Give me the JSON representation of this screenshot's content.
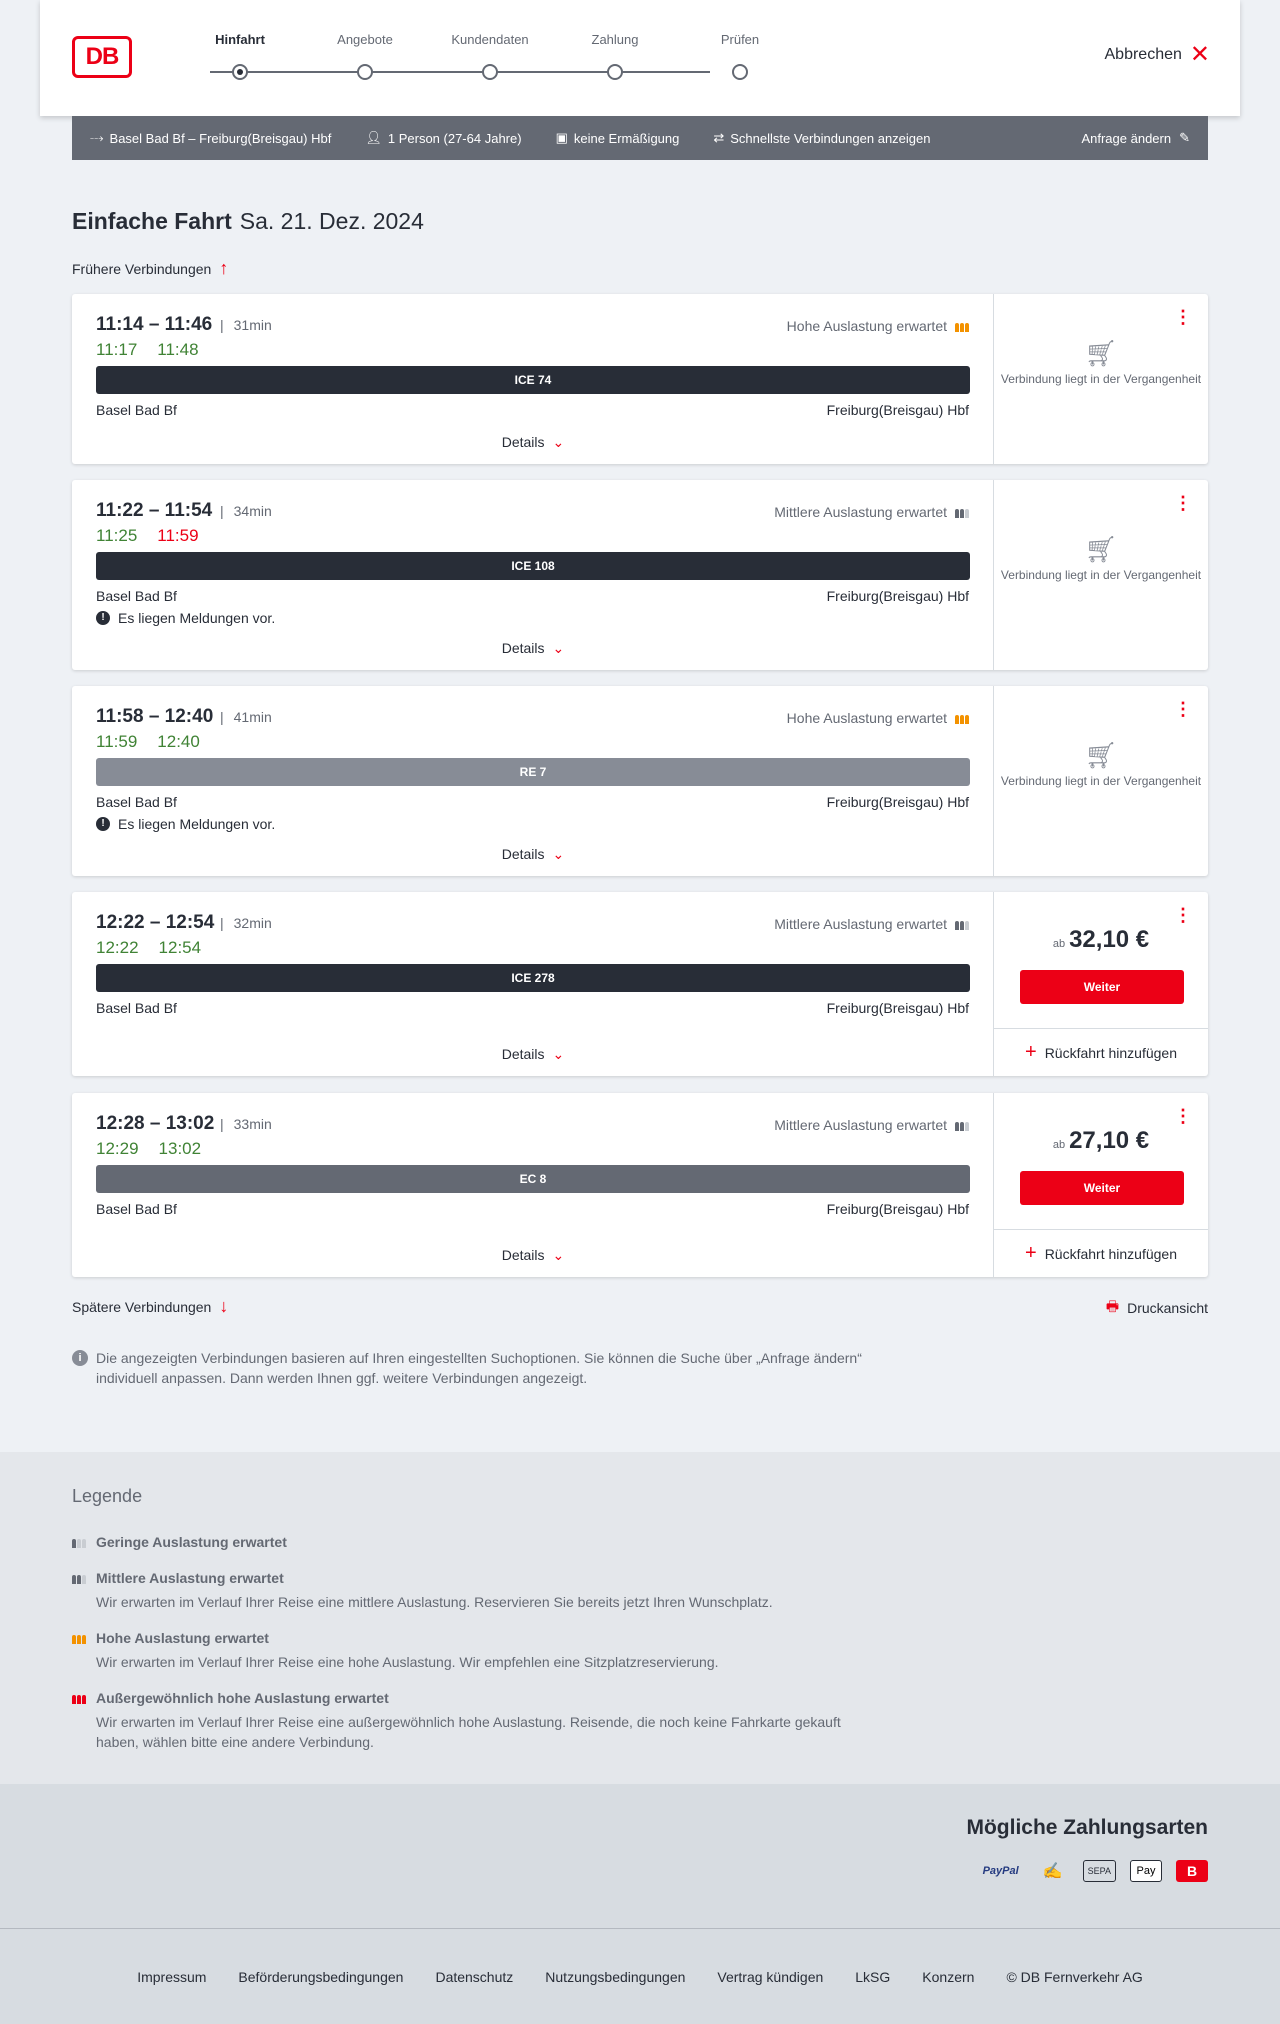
{
  "header": {
    "logo": "DB",
    "steps": [
      "Hinfahrt",
      "Angebote",
      "Kundendaten",
      "Zahlung",
      "Prüfen"
    ],
    "active_step": "Hinfahrt",
    "cancel_label": "Abbrechen"
  },
  "query": {
    "route": "Basel Bad Bf – Freiburg(Breisgau) Hbf",
    "passengers": "1 Person (27-64 Jahre)",
    "discount": "keine Ermäßigung",
    "option": "Schnellste Verbindungen anzeigen",
    "edit_label": "Anfrage ändern"
  },
  "title": {
    "kind": "Einfache Fahrt",
    "date": "Sa. 21. Dez. 2024"
  },
  "earlier_label": "Frühere Verbindungen",
  "later_label": "Spätere Verbindungen",
  "details_label": "Details",
  "past_label": "Verbindung liegt in der Vergangenheit",
  "price_prefix": "ab",
  "continue_label": "Weiter",
  "add_return_label": "Rückfahrt hinzufügen",
  "connections": [
    {
      "time": "11:14 – 11:46",
      "duration": "31min",
      "rt_dep": "11:17",
      "rt_arr": "11:48",
      "rt_arr_late": false,
      "occupancy": "Hohe Auslastung erwartet",
      "occupancy_level": "high",
      "train": "ICE 74",
      "train_style": "dark",
      "from": "Basel Bad Bf",
      "to": "Freiburg(Breisgau) Hbf",
      "message": "",
      "status": "past",
      "price": ""
    },
    {
      "time": "11:22 – 11:54",
      "duration": "34min",
      "rt_dep": "11:25",
      "rt_arr": "11:59",
      "rt_arr_late": true,
      "occupancy": "Mittlere Auslastung erwartet",
      "occupancy_level": "mid",
      "train": "ICE 108",
      "train_style": "dark",
      "from": "Basel Bad Bf",
      "to": "Freiburg(Breisgau) Hbf",
      "message": "Es liegen Meldungen vor.",
      "status": "past",
      "price": ""
    },
    {
      "time": "11:58 – 12:40",
      "duration": "41min",
      "rt_dep": "11:59",
      "rt_arr": "12:40",
      "rt_arr_late": false,
      "occupancy": "Hohe Auslastung erwartet",
      "occupancy_level": "high",
      "train": "RE 7",
      "train_style": "grey",
      "from": "Basel Bad Bf",
      "to": "Freiburg(Breisgau) Hbf",
      "message": "Es liegen Meldungen vor.",
      "status": "past",
      "price": ""
    },
    {
      "time": "12:22 – 12:54",
      "duration": "32min",
      "rt_dep": "12:22",
      "rt_arr": "12:54",
      "rt_arr_late": false,
      "occupancy": "Mittlere Auslastung erwartet",
      "occupancy_level": "mid",
      "train": "ICE 278",
      "train_style": "dark",
      "from": "Basel Bad Bf",
      "to": "Freiburg(Breisgau) Hbf",
      "message": "",
      "status": "bookable",
      "price": "32,10 €"
    },
    {
      "time": "12:28 – 13:02",
      "duration": "33min",
      "rt_dep": "12:29",
      "rt_arr": "13:02",
      "rt_arr_late": false,
      "occupancy": "Mittlere Auslastung erwartet",
      "occupancy_level": "mid",
      "train": "EC 8",
      "train_style": "mid",
      "from": "Basel Bad Bf",
      "to": "Freiburg(Breisgau) Hbf",
      "message": "",
      "status": "bookable",
      "price": "27,10 €"
    }
  ],
  "print_label": "Druckansicht",
  "info_note": "Die angezeigten Verbindungen basieren auf Ihren eingestellten Suchoptionen. Sie können die Suche über „Anfrage ändern“ individuell anpassen. Dann werden Ihnen ggf. weitere Verbindungen angezeigt.",
  "legend": {
    "title": "Legende",
    "items": [
      {
        "title": "Geringe Auslastung erwartet",
        "desc": "",
        "level": "low"
      },
      {
        "title": "Mittlere Auslastung erwartet",
        "desc": "Wir erwarten im Verlauf Ihrer Reise eine mittlere Auslastung. Reservieren Sie bereits jetzt Ihren Wunschplatz.",
        "level": "mid"
      },
      {
        "title": "Hohe Auslastung erwartet",
        "desc": "Wir erwarten im Verlauf Ihrer Reise eine hohe Auslastung. Wir empfehlen eine Sitzplatzreservierung.",
        "level": "high"
      },
      {
        "title": "Außergewöhnlich hohe Auslastung erwartet",
        "desc": "Wir erwarten im Verlauf Ihrer Reise eine außergewöhnlich hohe Auslastung. Reisende, die noch keine Fahrkarte gekauft haben, wählen bitte eine andere Verbindung.",
        "level": "very-high"
      }
    ]
  },
  "payment": {
    "title": "Mögliche Zahlungsarten",
    "methods": [
      "PayPal",
      "SEPA",
      "Pay"
    ]
  },
  "footer": [
    "Impressum",
    "Beförderungsbedingungen",
    "Datenschutz",
    "Nutzungsbedingungen",
    "Vertrag kündigen",
    "LkSG",
    "Konzern",
    "© DB Fernverkehr AG"
  ]
}
